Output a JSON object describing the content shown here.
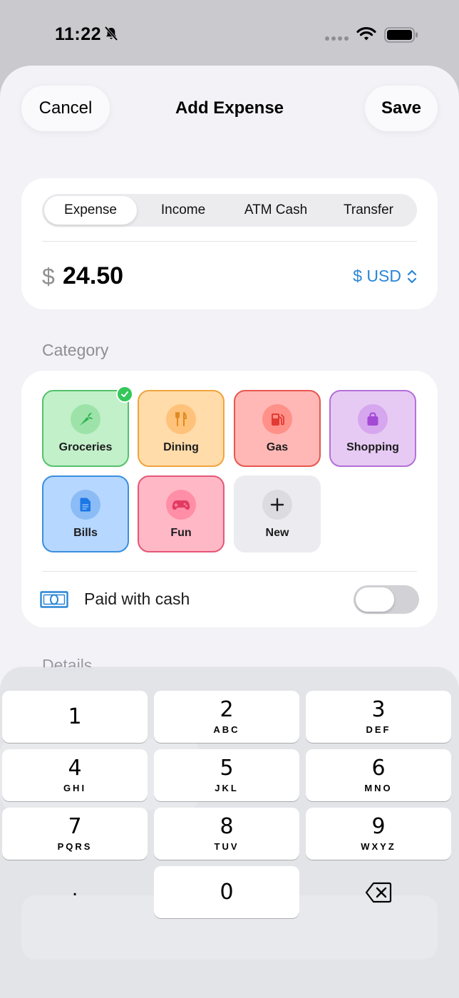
{
  "status_bar": {
    "time": "11:22"
  },
  "nav": {
    "cancel_label": "Cancel",
    "title": "Add Expense",
    "save_label": "Save"
  },
  "type_tabs": [
    {
      "label": "Expense",
      "selected": true
    },
    {
      "label": "Income",
      "selected": false
    },
    {
      "label": "ATM Cash",
      "selected": false
    },
    {
      "label": "Transfer",
      "selected": false
    }
  ],
  "amount": {
    "currency_symbol": "$",
    "value": "24.50",
    "currency_label": "$ USD"
  },
  "category": {
    "section_label": "Category",
    "items": [
      {
        "label": "Groceries",
        "icon": "carrot-icon",
        "selected": true,
        "bg": "#c2f0c9",
        "border": "#52c26b",
        "icon_bg": "#9de3a9",
        "icon_color": "#2fb24f"
      },
      {
        "label": "Dining",
        "icon": "fork-knife-icon",
        "selected": false,
        "bg": "#ffdcaa",
        "border": "#f0a43c",
        "icon_bg": "#ffc27a",
        "icon_color": "#e08a1f"
      },
      {
        "label": "Gas",
        "icon": "fuel-pump-icon",
        "selected": false,
        "bg": "#ffb8b5",
        "border": "#e8564f",
        "icon_bg": "#ff9189",
        "icon_color": "#e23b34"
      },
      {
        "label": "Shopping",
        "icon": "shopping-bag-icon",
        "selected": false,
        "bg": "#e7caf3",
        "border": "#b46fd9",
        "icon_bg": "#d6a6ee",
        "icon_color": "#a449d6"
      },
      {
        "label": "Bills",
        "icon": "document-icon",
        "selected": false,
        "bg": "#b6d7ff",
        "border": "#3b8fe0",
        "icon_bg": "#8cbcf5",
        "icon_color": "#1b78e6"
      },
      {
        "label": "Fun",
        "icon": "gamecontroller-icon",
        "selected": false,
        "bg": "#ffb8c6",
        "border": "#e55777",
        "icon_bg": "#ff8ea6",
        "icon_color": "#e23a61"
      },
      {
        "label": "New",
        "icon": "plus-icon",
        "selected": false,
        "bg": "#ececf0",
        "border": "#ececf0",
        "icon_bg": "#dcdce0",
        "icon_color": "#1c1c1e"
      }
    ]
  },
  "cash": {
    "label": "Paid with cash",
    "enabled": false
  },
  "details": {
    "section_label": "Details"
  },
  "keypad": {
    "keys": [
      {
        "digit": "1",
        "letters": ""
      },
      {
        "digit": "2",
        "letters": "ABC"
      },
      {
        "digit": "3",
        "letters": "DEF"
      },
      {
        "digit": "4",
        "letters": "GHI"
      },
      {
        "digit": "5",
        "letters": "JKL"
      },
      {
        "digit": "6",
        "letters": "MNO"
      },
      {
        "digit": "7",
        "letters": "PQRS"
      },
      {
        "digit": "8",
        "letters": "TUV"
      },
      {
        "digit": "9",
        "letters": "WXYZ"
      }
    ],
    "decimal": ".",
    "zero": "0",
    "delete_icon": "delete-left-icon"
  },
  "colors": {
    "accent": "#2a86d6",
    "sheet_bg": "#f2f2f7",
    "success": "#34c759"
  }
}
